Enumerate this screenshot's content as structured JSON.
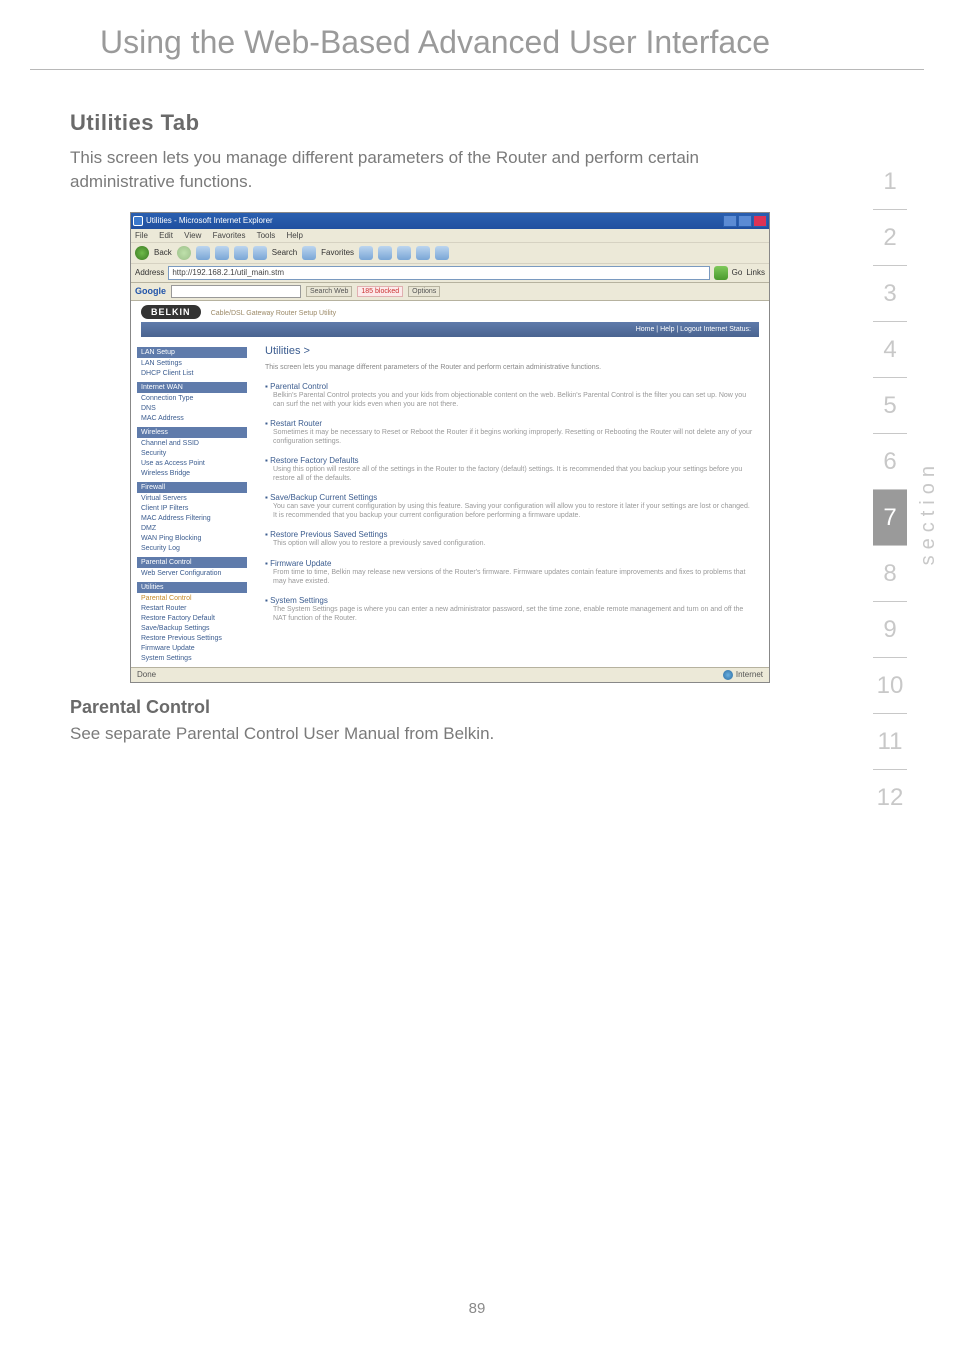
{
  "page_title": "Using the Web-Based Advanced User Interface",
  "section_nav": {
    "label": "section",
    "active": 7,
    "items": [
      1,
      2,
      3,
      4,
      5,
      6,
      7,
      8,
      9,
      10,
      11,
      12
    ]
  },
  "page_number": "89",
  "utilities": {
    "heading": "Utilities Tab",
    "body": "This screen lets you manage different parameters of the Router and perform certain administrative functions."
  },
  "parental": {
    "heading": "Parental Control",
    "body": "See separate Parental Control User Manual from Belkin."
  },
  "browser": {
    "title": "Utilities - Microsoft Internet Explorer",
    "menu": [
      "File",
      "Edit",
      "View",
      "Favorites",
      "Tools",
      "Help"
    ],
    "toolbar": {
      "back": "Back",
      "search": "Search",
      "favorites": "Favorites"
    },
    "address_label": "Address",
    "address_value": "http://192.168.2.1/util_main.stm",
    "go_label": "Go",
    "links_label": "Links",
    "google": {
      "label": "Google",
      "search_btn": "Search Web",
      "popups": "185 blocked",
      "options": "Options"
    },
    "status": {
      "left": "Done",
      "right": "Internet"
    }
  },
  "router_ui": {
    "brand": "BELKIN",
    "tagline": "Cable/DSL Gateway Router Setup Utility",
    "topband": "Home | Help | Logout     Internet Status:",
    "sidebar": [
      {
        "type": "hdr",
        "label": "LAN Setup"
      },
      {
        "type": "link",
        "label": "LAN Settings"
      },
      {
        "type": "link",
        "label": "DHCP Client List"
      },
      {
        "type": "hdr",
        "label": "Internet WAN"
      },
      {
        "type": "link",
        "label": "Connection Type"
      },
      {
        "type": "link",
        "label": "DNS"
      },
      {
        "type": "link",
        "label": "MAC Address"
      },
      {
        "type": "hdr",
        "label": "Wireless"
      },
      {
        "type": "link",
        "label": "Channel and SSID"
      },
      {
        "type": "link",
        "label": "Security"
      },
      {
        "type": "link",
        "label": "Use as Access Point"
      },
      {
        "type": "link",
        "label": "Wireless Bridge"
      },
      {
        "type": "hdr",
        "label": "Firewall"
      },
      {
        "type": "link",
        "label": "Virtual Servers"
      },
      {
        "type": "link",
        "label": "Client IP Filters"
      },
      {
        "type": "link",
        "label": "MAC Address Filtering"
      },
      {
        "type": "link",
        "label": "DMZ"
      },
      {
        "type": "link",
        "label": "WAN Ping Blocking"
      },
      {
        "type": "link",
        "label": "Security Log"
      },
      {
        "type": "hdr",
        "label": "Parental Control"
      },
      {
        "type": "link",
        "label": "Web Server Configuration"
      },
      {
        "type": "hdr",
        "label": "Utilities"
      },
      {
        "type": "link",
        "label": "Parental Control",
        "sel": true
      },
      {
        "type": "link",
        "label": "Restart Router"
      },
      {
        "type": "link",
        "label": "Restore Factory Default"
      },
      {
        "type": "link",
        "label": "Save/Backup Settings"
      },
      {
        "type": "link",
        "label": "Restore Previous Settings"
      },
      {
        "type": "link",
        "label": "Firmware Update"
      },
      {
        "type": "link",
        "label": "System Settings"
      }
    ],
    "main": {
      "heading": "Utilities >",
      "intro": "This screen lets you manage different parameters of the Router and perform certain administrative functions.",
      "items": [
        {
          "head": "Parental Control",
          "body": "Belkin's Parental Control protects you and your kids from objectionable content on the web. Belkin's Parental Control is the filter you can set up. Now you can surf the net with your kids even when you are not there."
        },
        {
          "head": "Restart Router",
          "body": "Sometimes it may be necessary to Reset or Reboot the Router if it begins working improperly. Resetting or Rebooting the Router will not delete any of your configuration settings."
        },
        {
          "head": "Restore Factory Defaults",
          "body": "Using this option will restore all of the settings in the Router to the factory (default) settings. It is recommended that you backup your settings before you restore all of the defaults."
        },
        {
          "head": "Save/Backup Current Settings",
          "body": "You can save your current configuration by using this feature. Saving your configuration will allow you to restore it later if your settings are lost or changed. It is recommended that you backup your current configuration before performing a firmware update."
        },
        {
          "head": "Restore Previous Saved Settings",
          "body": "This option will allow you to restore a previously saved configuration."
        },
        {
          "head": "Firmware Update",
          "body": "From time to time, Belkin may release new versions of the Router's firmware. Firmware updates contain feature improvements and fixes to problems that may have existed."
        },
        {
          "head": "System Settings",
          "body": "The System Settings page is where you can enter a new administrator password, set the time zone, enable remote management and turn on and off the NAT function of the Router."
        }
      ]
    }
  }
}
